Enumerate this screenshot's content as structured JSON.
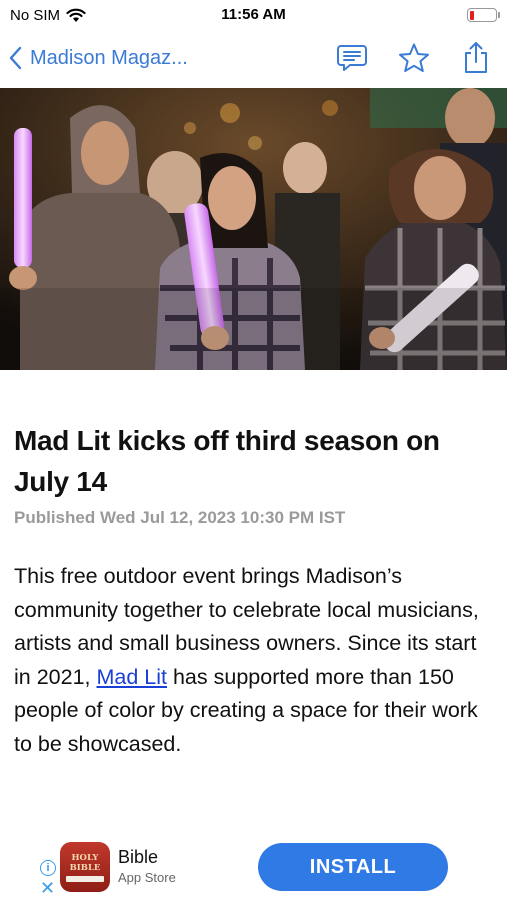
{
  "status_bar": {
    "carrier": "No SIM",
    "time": "11:56 AM"
  },
  "nav": {
    "back_label": "Madison Magaz..."
  },
  "article": {
    "headline": "Mad Lit kicks off third season on July 14",
    "published": "Published Wed Jul 12, 2023 10:30 PM IST",
    "body_before_link": "This free outdoor event brings Madison’s community together to celebrate local musicians, artists and small business owners. Since its start in 2021, ",
    "link_text": "Mad Lit",
    "body_after_link": " has supported more than 150 people of color by creating a space for their work to be showcased."
  },
  "ad": {
    "app_icon_text_line1": "HOLY",
    "app_icon_text_line2": "BIBLE",
    "title": "Bible",
    "subtitle": "App Store",
    "install_label": "INSTALL"
  },
  "colors": {
    "accent": "#3a7bd5",
    "link": "#1a3fd6",
    "install": "#2f7ae5",
    "battery_low": "#e02020"
  }
}
